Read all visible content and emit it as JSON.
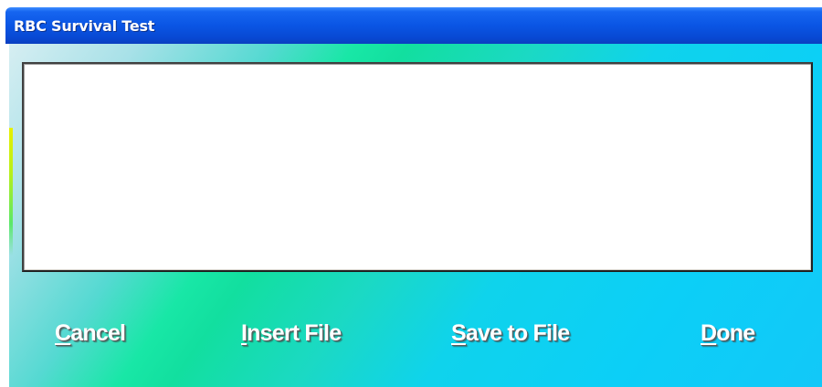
{
  "window": {
    "title": "RBC Survival Test"
  },
  "text_area": {
    "value": ""
  },
  "buttons": {
    "cancel": {
      "mnemonic": "C",
      "rest": "ancel"
    },
    "insert_file": {
      "mnemonic": "I",
      "rest": "nsert File"
    },
    "save_to_file": {
      "mnemonic": "S",
      "rest": "ave to File"
    },
    "done": {
      "mnemonic": "D",
      "rest": "one"
    }
  },
  "colors": {
    "titlebar": "#0a55e4",
    "title_text": "#ffffff",
    "client_gradient_start": "#18e7a6",
    "client_gradient_end": "#12c8f8",
    "button_text": "#ffffff",
    "text_area_background": "#ffffff"
  }
}
